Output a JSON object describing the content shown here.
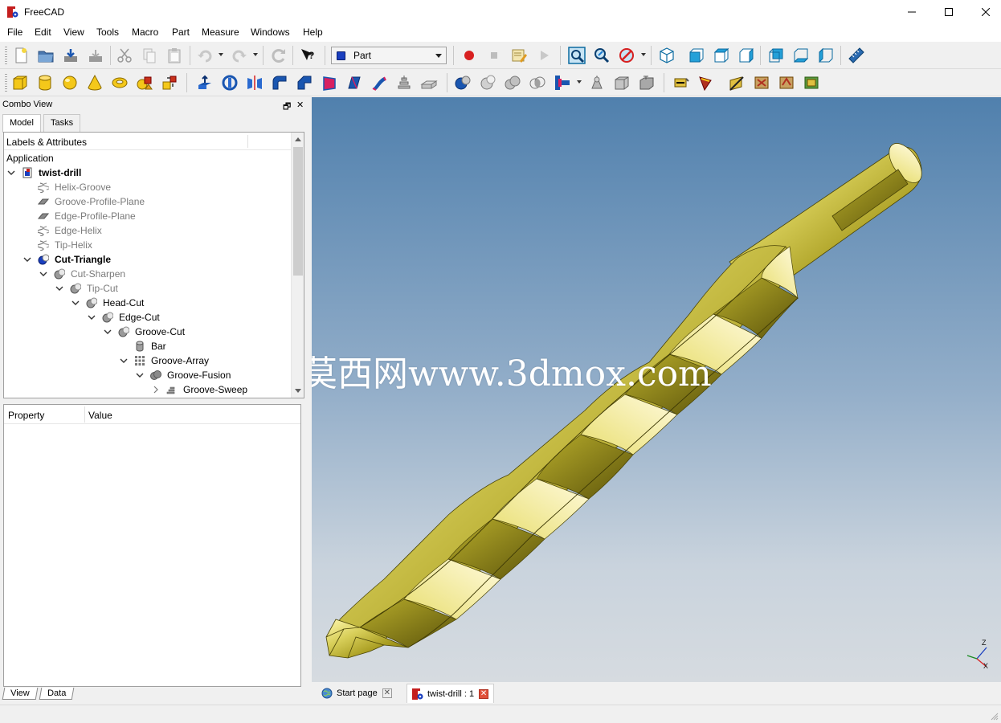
{
  "window": {
    "title": "FreeCAD"
  },
  "menu": [
    "File",
    "Edit",
    "View",
    "Tools",
    "Macro",
    "Part",
    "Measure",
    "Windows",
    "Help"
  ],
  "workbench_selector": {
    "value": "Part"
  },
  "combo_view": {
    "title": "Combo View",
    "tabs": [
      "Model",
      "Tasks"
    ],
    "tree_header": "Labels & Attributes",
    "application_label": "Application",
    "tree": [
      {
        "label": "twist-drill",
        "depth": 0,
        "expander": "open",
        "icon": "document-icon",
        "bold": true,
        "dim": false
      },
      {
        "label": "Helix-Groove",
        "depth": 1,
        "expander": "none",
        "icon": "helix-icon",
        "bold": false,
        "dim": true
      },
      {
        "label": "Groove-Profile-Plane",
        "depth": 1,
        "expander": "none",
        "icon": "plane-icon",
        "bold": false,
        "dim": true
      },
      {
        "label": "Edge-Profile-Plane",
        "depth": 1,
        "expander": "none",
        "icon": "plane-icon",
        "bold": false,
        "dim": true
      },
      {
        "label": "Edge-Helix",
        "depth": 1,
        "expander": "none",
        "icon": "helix-icon",
        "bold": false,
        "dim": true
      },
      {
        "label": "Tip-Helix",
        "depth": 1,
        "expander": "none",
        "icon": "helix-icon",
        "bold": false,
        "dim": true
      },
      {
        "label": "Cut-Triangle",
        "depth": 1,
        "expander": "open",
        "icon": "cut-icon",
        "bold": true,
        "dim": false
      },
      {
        "label": "Cut-Sharpen",
        "depth": 2,
        "expander": "open",
        "icon": "cut-icon",
        "bold": false,
        "dim": true
      },
      {
        "label": "Tip-Cut",
        "depth": 3,
        "expander": "open",
        "icon": "cut-icon",
        "bold": false,
        "dim": true
      },
      {
        "label": "Head-Cut",
        "depth": 4,
        "expander": "open",
        "icon": "cut-icon",
        "bold": false,
        "dim": false
      },
      {
        "label": "Edge-Cut",
        "depth": 5,
        "expander": "open",
        "icon": "cut-icon",
        "bold": false,
        "dim": false
      },
      {
        "label": "Groove-Cut",
        "depth": 6,
        "expander": "open",
        "icon": "cut-icon",
        "bold": false,
        "dim": false
      },
      {
        "label": "Bar",
        "depth": 7,
        "expander": "none",
        "icon": "cylinder-icon",
        "bold": false,
        "dim": false
      },
      {
        "label": "Groove-Array",
        "depth": 7,
        "expander": "open",
        "icon": "array-icon",
        "bold": false,
        "dim": false
      },
      {
        "label": "Groove-Fusion",
        "depth": 8,
        "expander": "open",
        "icon": "fusion-icon",
        "bold": false,
        "dim": false
      },
      {
        "label": "Groove-Sweep",
        "depth": 9,
        "expander": "closed",
        "icon": "sweep-icon",
        "bold": false,
        "dim": false
      }
    ],
    "property_columns": [
      "Property",
      "Value"
    ],
    "bottom_tabs": [
      "View",
      "Data"
    ]
  },
  "view3d": {
    "watermark": "莫西网www.3dmox.com",
    "axis_labels": {
      "z": "Z",
      "x": "X"
    },
    "model_color": "#c8c03a"
  },
  "view_tabs": [
    {
      "label": "Start page",
      "icon": "globe-icon",
      "active": false
    },
    {
      "label": "twist-drill : 1",
      "icon": "freecad-icon",
      "active": true
    }
  ],
  "colors": {
    "accent_blue": "#1a56b0",
    "record_red": "#d82020"
  }
}
